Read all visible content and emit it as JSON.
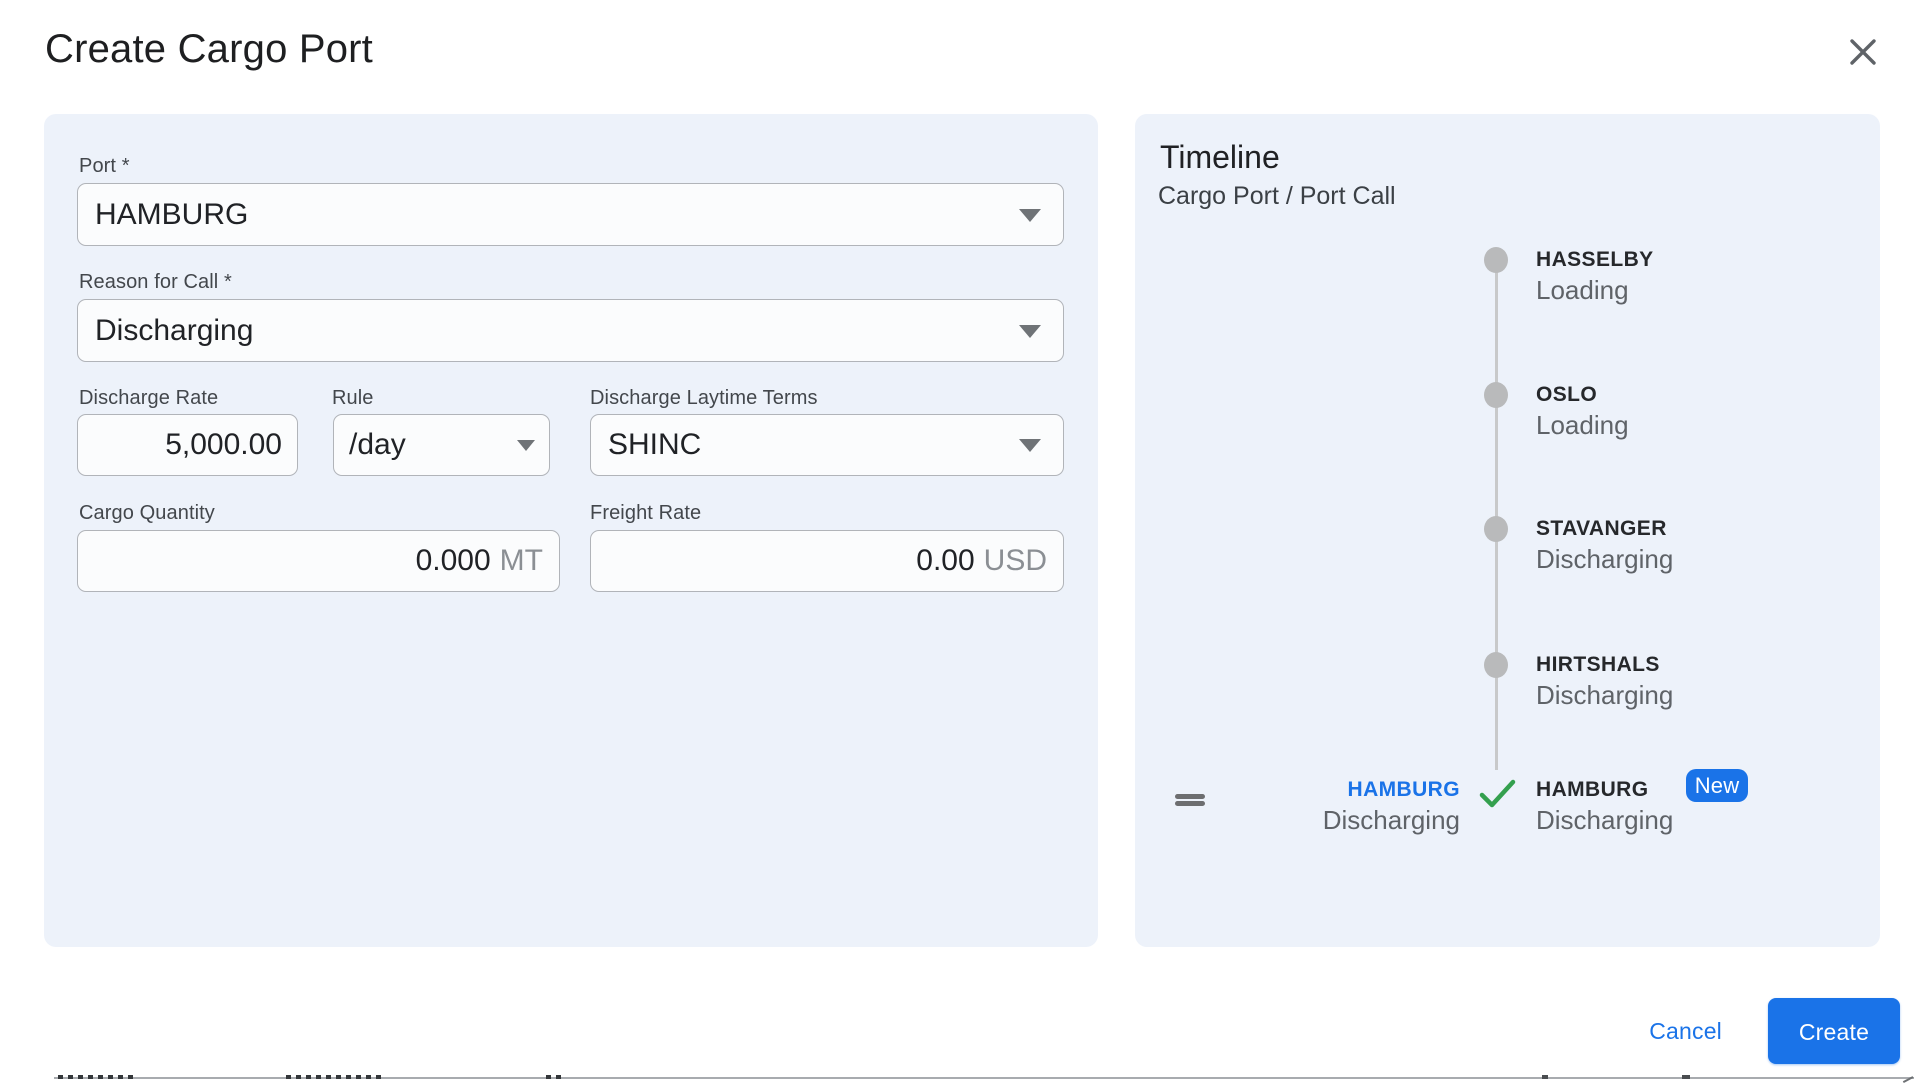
{
  "dialog": {
    "title": "Create Cargo Port"
  },
  "form": {
    "port": {
      "label": "Port *",
      "value": "HAMBURG"
    },
    "reason": {
      "label": "Reason for Call *",
      "value": "Discharging"
    },
    "discharge_rate": {
      "label": "Discharge Rate",
      "value": "5,000.00"
    },
    "rule": {
      "label": "Rule",
      "value": "/day"
    },
    "laytime": {
      "label": "Discharge Laytime Terms",
      "value": "SHINC"
    },
    "cargo_quantity": {
      "label": "Cargo Quantity",
      "value": "0.000",
      "unit": "MT"
    },
    "freight_rate": {
      "label": "Freight Rate",
      "value": "0.00",
      "unit": "USD"
    }
  },
  "timeline": {
    "title": "Timeline",
    "subtitle": "Cargo Port / Port Call",
    "items": [
      {
        "port": "HASSELBY",
        "activity": "Loading"
      },
      {
        "port": "OSLO",
        "activity": "Loading"
      },
      {
        "port": "STAVANGER",
        "activity": "Discharging"
      },
      {
        "port": "HIRTSHALS",
        "activity": "Discharging"
      }
    ],
    "new_item": {
      "port": "HAMBURG",
      "activity": "Discharging",
      "badge": "New",
      "drag_label_port": "HAMBURG",
      "drag_label_activity": "Discharging"
    }
  },
  "footer": {
    "cancel_label": "Cancel",
    "create_label": "Create"
  },
  "colors": {
    "accent_blue": "#1a73e8",
    "success_green": "#34a04e",
    "panel_bg": "#edf2fa",
    "dot_gray": "#b9babb",
    "status_gray": "#5f6368"
  }
}
